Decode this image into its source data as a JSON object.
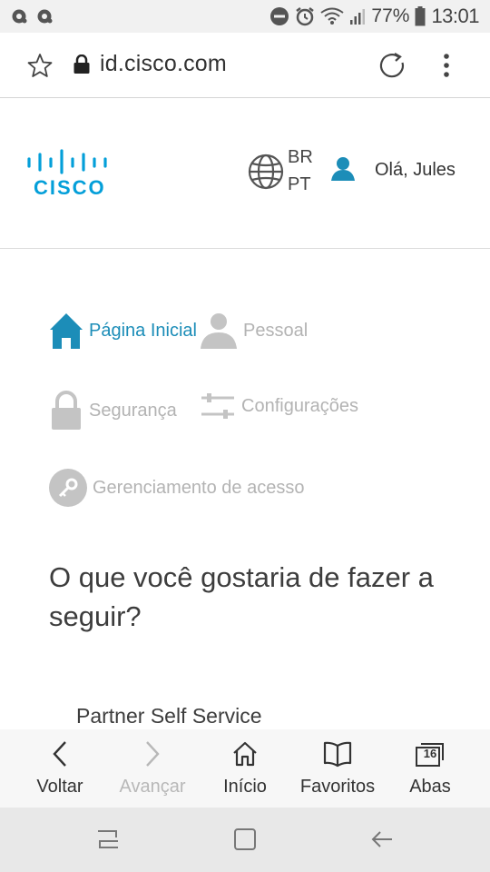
{
  "status_bar": {
    "battery": "77%",
    "time": "13:01"
  },
  "url_bar": {
    "url": "id.cisco.com"
  },
  "header": {
    "logo_text": "CISCO",
    "language_line1": "BR",
    "language_line2": "PT",
    "greeting": "Olá, Jules",
    "brand_color": "#049fd9"
  },
  "nav": {
    "home": "Página Inicial",
    "personal": "Pessoal",
    "security": "Segurança",
    "settings": "Configurações",
    "access": "Gerenciamento de acesso",
    "active_color": "#1c8db8",
    "inactive_color": "#b3b3b3"
  },
  "main": {
    "question": "O que você gostaria de fazer a seguir?",
    "partner_self_service": "Partner Self Service"
  },
  "toolbar": {
    "back": "Voltar",
    "forward": "Avançar",
    "home": "Início",
    "favorites": "Favoritos",
    "tabs": "Abas",
    "tab_count": "16"
  }
}
